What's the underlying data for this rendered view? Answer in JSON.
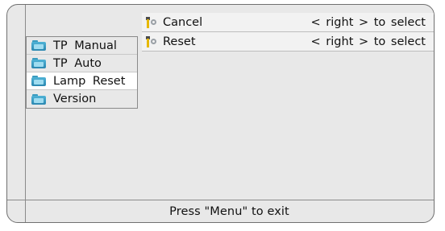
{
  "submenu": {
    "items": [
      {
        "label": "TP Manual",
        "icon": "folder-icon",
        "selected": false
      },
      {
        "label": "TP Auto",
        "icon": "folder-icon",
        "selected": false
      },
      {
        "label": "Lamp Reset",
        "icon": "folder-icon",
        "selected": true
      },
      {
        "label": "Version",
        "icon": "folder-icon",
        "selected": false
      }
    ]
  },
  "options": [
    {
      "label": "Cancel",
      "hint": "< right > to select",
      "icon": "lamp-icon"
    },
    {
      "label": "Reset",
      "hint": "< right > to select",
      "icon": "lamp-icon"
    }
  ],
  "footer": {
    "text": "Press \"Menu\" to exit"
  },
  "colors": {
    "panel": "#e8e8e8",
    "selected_row": "#ffffff",
    "folder": "#3a9bbf",
    "lamp": "#e6b800"
  }
}
